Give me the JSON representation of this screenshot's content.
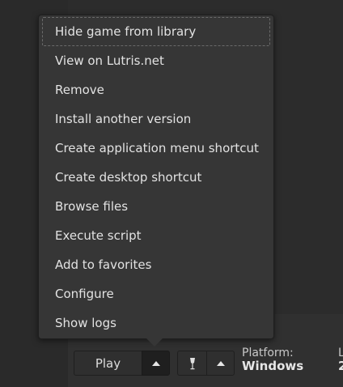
{
  "menu": {
    "items": [
      {
        "label": "Hide game from library"
      },
      {
        "label": "View on Lutris.net"
      },
      {
        "label": "Remove"
      },
      {
        "label": "Install another version"
      },
      {
        "label": "Create application menu shortcut"
      },
      {
        "label": "Create desktop shortcut"
      },
      {
        "label": "Browse files"
      },
      {
        "label": "Execute script"
      },
      {
        "label": "Add to favorites"
      },
      {
        "label": "Configure"
      },
      {
        "label": "Show logs"
      }
    ],
    "focused_index": 0
  },
  "toolbar": {
    "play_label": "Play",
    "play_toggle_icon": "chevron-up-icon",
    "tool_icon": "wine-glass-icon",
    "tool_toggle_icon": "chevron-up-icon"
  },
  "info": {
    "platform_label": "Platform:",
    "platform_value": "Windows",
    "clipped_label": "L",
    "clipped_value": "2"
  },
  "colors": {
    "background": "#2c2c2c",
    "menu_background": "#363636",
    "text": "#e2e2e2"
  }
}
